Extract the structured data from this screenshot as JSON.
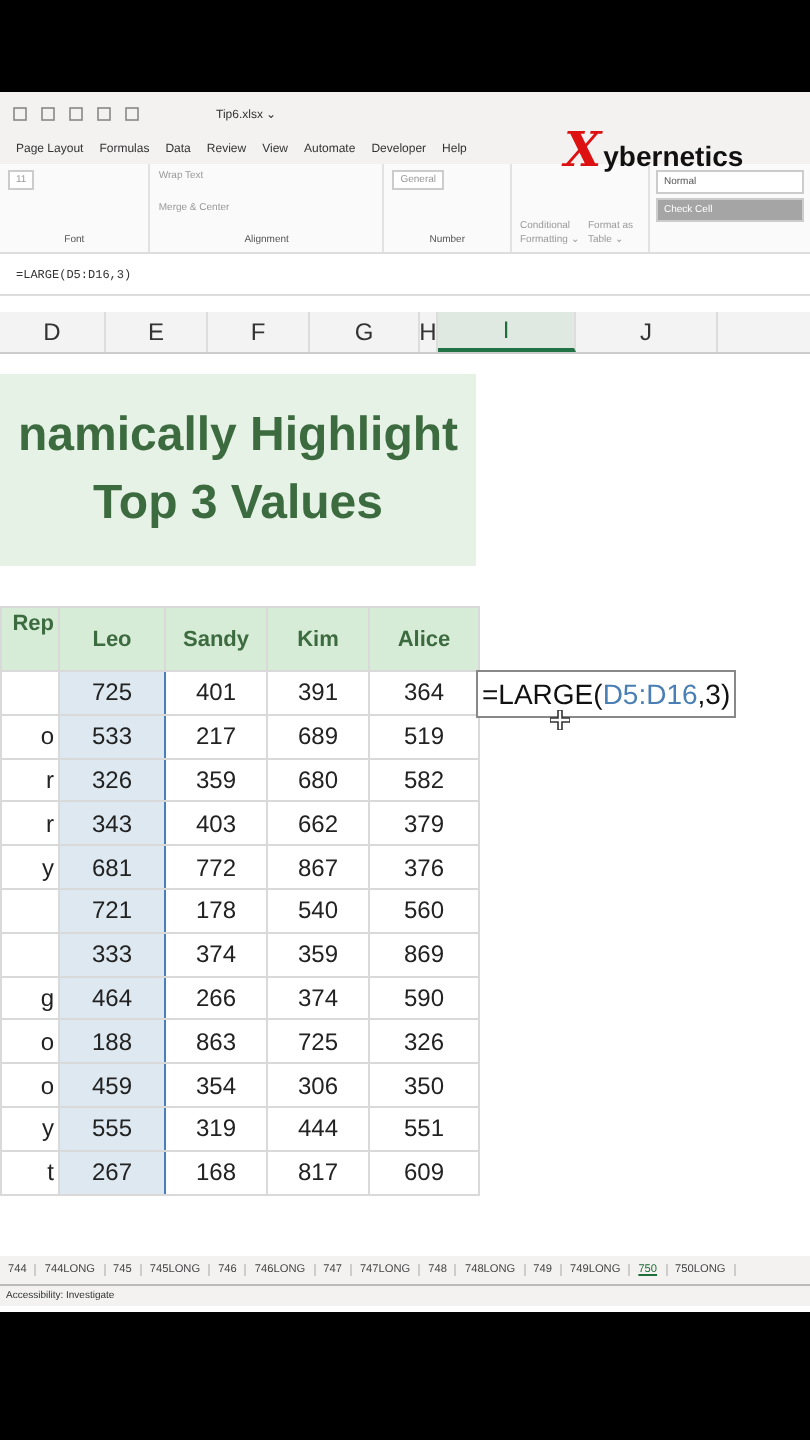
{
  "title_bar": {
    "filename": "Tip6.xlsx",
    "caret": "⌄"
  },
  "menu": [
    "Page Layout",
    "Formulas",
    "Data",
    "Review",
    "View",
    "Automate",
    "Developer",
    "Help"
  ],
  "logo": {
    "mark": "X",
    "text": "ybernetics"
  },
  "ribbon": {
    "font_size": "11",
    "wrap_text": "Wrap Text",
    "merge": "Merge & Center",
    "number_format": "General",
    "conditional": "Conditional Formatting ⌄",
    "format_table": "Format as Table ⌄",
    "styles": [
      {
        "label": "Normal",
        "kind": "normal"
      },
      {
        "label": "Check Cell",
        "kind": "check"
      }
    ],
    "groups": [
      "Font",
      "Alignment",
      "Number"
    ]
  },
  "formula_bar": {
    "value": "=LARGE(D5:D16,3)"
  },
  "columns": [
    {
      "label": "D",
      "selected": false
    },
    {
      "label": "E",
      "selected": false
    },
    {
      "label": "F",
      "selected": false
    },
    {
      "label": "G",
      "selected": false
    },
    {
      "label": "H",
      "selected": false
    },
    {
      "label": "I",
      "selected": true
    },
    {
      "label": "J",
      "selected": false
    }
  ],
  "heading": [
    "namically Highlight",
    "Top 3 Values"
  ],
  "table": {
    "columns": [
      "Rep",
      "Leo",
      "Sandy",
      "Kim",
      "Alice"
    ],
    "rows": [
      [
        "",
        "725",
        "401",
        "391",
        "364"
      ],
      [
        "o",
        "533",
        "217",
        "689",
        "519"
      ],
      [
        "r",
        "326",
        "359",
        "680",
        "582"
      ],
      [
        "r",
        "343",
        "403",
        "662",
        "379"
      ],
      [
        "y",
        "681",
        "772",
        "867",
        "376"
      ],
      [
        "",
        "721",
        "178",
        "540",
        "560"
      ],
      [
        "",
        "333",
        "374",
        "359",
        "869"
      ],
      [
        "g",
        "464",
        "266",
        "374",
        "590"
      ],
      [
        "o",
        "188",
        "863",
        "725",
        "326"
      ],
      [
        "o",
        "459",
        "354",
        "306",
        "350"
      ],
      [
        "y",
        "555",
        "319",
        "444",
        "551"
      ],
      [
        "t",
        "267",
        "168",
        "817",
        "609"
      ]
    ]
  },
  "formula_cell": [
    {
      "text": "=LARGE(",
      "kind": "plain"
    },
    {
      "text": "D5:D16",
      "kind": "ref"
    },
    {
      "text": ",3)",
      "kind": "plain"
    }
  ],
  "sheet_tabs": [
    {
      "label": "744",
      "selected": false
    },
    {
      "label": "744LONG",
      "selected": false
    },
    {
      "label": "745",
      "selected": false
    },
    {
      "label": "745LONG",
      "selected": false
    },
    {
      "label": "746",
      "selected": false
    },
    {
      "label": "746LONG",
      "selected": false
    },
    {
      "label": "747",
      "selected": false
    },
    {
      "label": "747LONG",
      "selected": false
    },
    {
      "label": "748",
      "selected": false
    },
    {
      "label": "748LONG",
      "selected": false
    },
    {
      "label": "749",
      "selected": false
    },
    {
      "label": "749LONG",
      "selected": false
    },
    {
      "label": "750",
      "selected": true
    },
    {
      "label": "750LONG",
      "selected": false
    }
  ],
  "status_bar": {
    "accessibility": "Accessibility: Investigate"
  }
}
